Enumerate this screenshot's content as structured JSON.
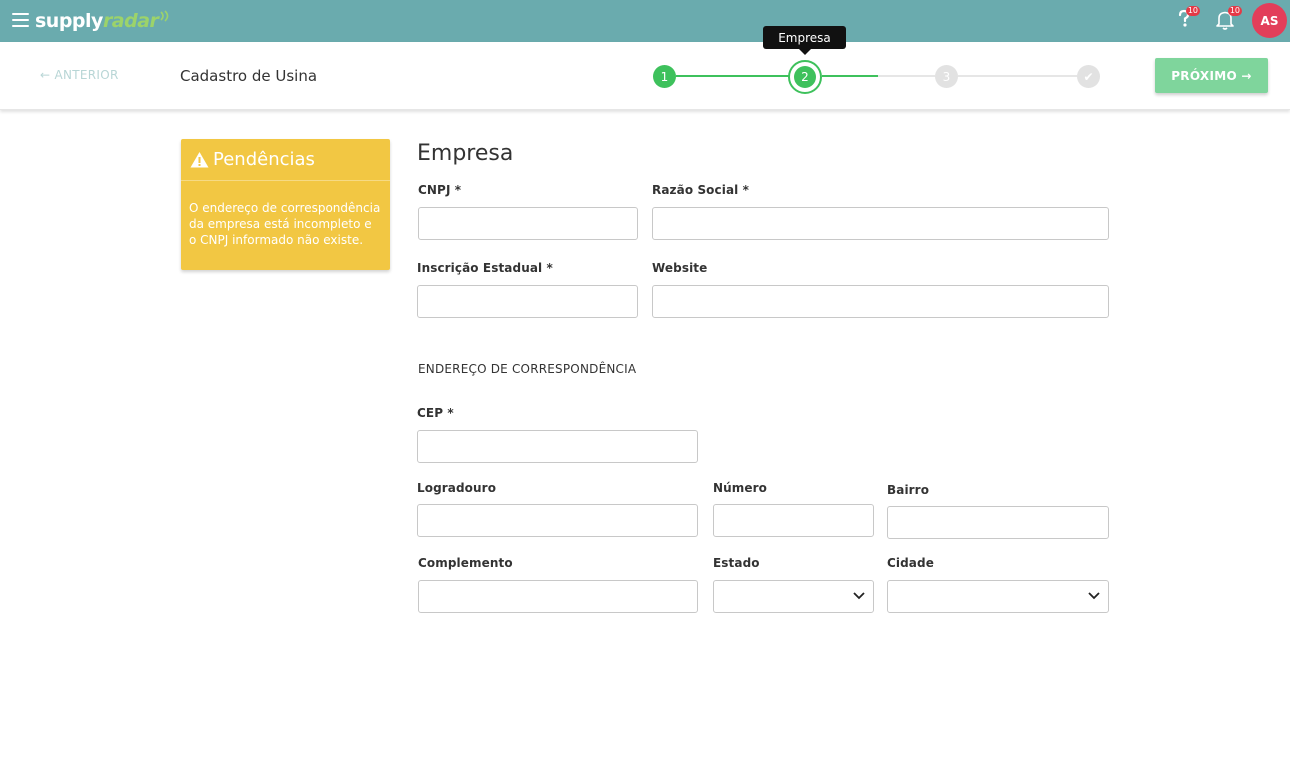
{
  "header": {
    "logo_supply": "supply",
    "logo_radar": "radar",
    "help_badge": "10",
    "notification_badge": "10",
    "avatar_initials": "AS",
    "bar_color": "#6aabae",
    "avatar_color": "#e23e5a"
  },
  "stepper": {
    "prev_label": "← ANTERIOR",
    "page_title": "Cadastro de Usina",
    "steps": [
      "1",
      "2",
      "3",
      "✔"
    ],
    "current_step": 2,
    "tooltip": "Empresa",
    "next_label": "PRÓXIMO →",
    "active_color": "#3ec15c",
    "inactive_color": "#e2e2e2"
  },
  "pending": {
    "title": "Pendências",
    "message": "O endereço de correspondência da empresa está incompleto e o CNPJ informado não existe.",
    "color": "#f2c743"
  },
  "form": {
    "section_title": "Empresa",
    "cnpj_label": "CNPJ *",
    "cnpj_value": "",
    "razao_label": "Razão Social *",
    "razao_value": "",
    "inscricao_label": "Inscrição Estadual *",
    "inscricao_value": "",
    "website_label": "Website",
    "website_value": "",
    "address_heading": "ENDEREÇO DE CORRESPONDÊNCIA",
    "cep_label": "CEP *",
    "cep_value": "",
    "logradouro_label": "Logradouro",
    "logradouro_value": "",
    "numero_label": "Número",
    "numero_value": "",
    "bairro_label": "Bairro",
    "bairro_value": "",
    "complemento_label": "Complemento",
    "complemento_value": "",
    "estado_label": "Estado",
    "estado_value": "",
    "cidade_label": "Cidade",
    "cidade_value": ""
  }
}
